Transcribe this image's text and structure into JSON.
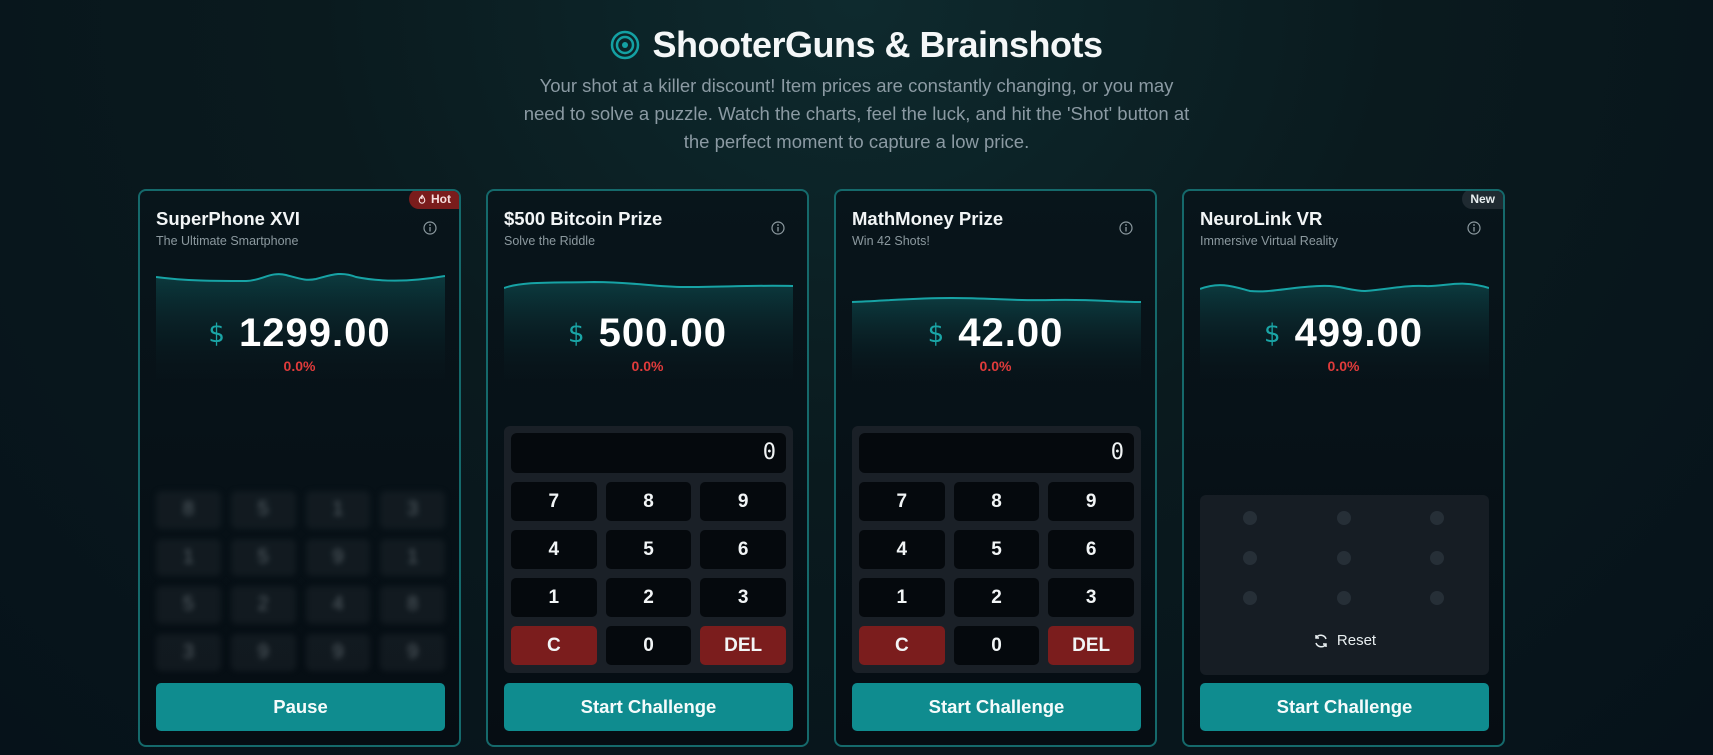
{
  "header": {
    "title": "ShooterGuns & Brainshots",
    "subtitle": "Your shot at a killer discount! Item prices are constantly changing, or you may need to solve a puzzle. Watch the charts, feel the luck, and hit the 'Shot' button at the perfect moment to capture a low price.",
    "icon": "target-icon",
    "accent_color": "#14a0a3"
  },
  "cards": [
    {
      "name": "SuperPhone XVI",
      "tagline": "The Ultimate Smartphone",
      "badge": "Hot",
      "badge_icon": "flame-icon",
      "currency": "$",
      "price": "1299.00",
      "change": "0.0%",
      "hidden_digits": [
        "8",
        "5",
        "1",
        "3",
        "1",
        "5",
        "9",
        "1",
        "5",
        "2",
        "4",
        "8",
        "3",
        "9",
        "9",
        "9"
      ],
      "action": "Pause"
    },
    {
      "name": "$500 Bitcoin Prize",
      "tagline": "Solve the Riddle",
      "currency": "$",
      "price": "500.00",
      "change": "0.0%",
      "display": "0",
      "keys": [
        "7",
        "8",
        "9",
        "4",
        "5",
        "6",
        "1",
        "2",
        "3",
        "C",
        "0",
        "DEL"
      ],
      "action": "Start Challenge"
    },
    {
      "name": "MathMoney Prize",
      "tagline": "Win 42 Shots!",
      "currency": "$",
      "price": "42.00",
      "change": "0.0%",
      "display": "0",
      "keys": [
        "7",
        "8",
        "9",
        "4",
        "5",
        "6",
        "1",
        "2",
        "3",
        "C",
        "0",
        "DEL"
      ],
      "action": "Start Challenge"
    },
    {
      "name": "NeuroLink VR",
      "tagline": "Immersive Virtual Reality",
      "badge": "New",
      "currency": "$",
      "price": "499.00",
      "change": "0.0%",
      "reset_label": "Reset",
      "action": "Start Challenge"
    }
  ]
}
